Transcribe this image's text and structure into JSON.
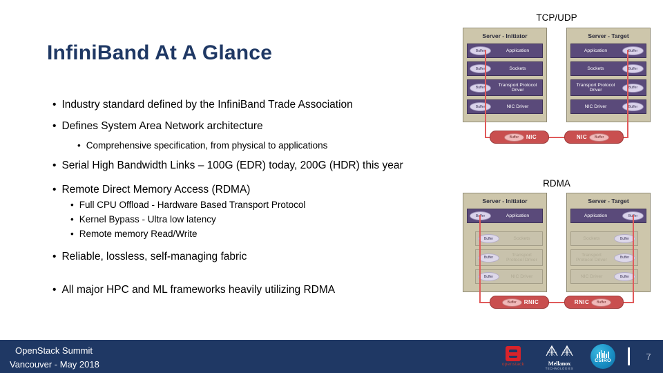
{
  "slide": {
    "title": "InfiniBand At A Glance",
    "number": "7"
  },
  "bullets": [
    {
      "level": 1,
      "text": "Industry standard defined by the InfiniBand Trade Association"
    },
    {
      "level": 1,
      "text": "Defines System Area Network architecture"
    },
    {
      "level": 2,
      "text": "Comprehensive specification, from physical to applications"
    },
    {
      "level": 1,
      "text": "Serial High Bandwidth Links – 100G (EDR) today, 200G (HDR) this year"
    },
    {
      "level": 1,
      "text": "Remote Direct Memory Access (RDMA)"
    },
    {
      "level": 2,
      "text": "Full CPU Offload - Hardware Based Transport Protocol"
    },
    {
      "level": 2,
      "text": "Kernel Bypass - Ultra low latency"
    },
    {
      "level": 2,
      "text": "Remote memory Read/Write"
    },
    {
      "level": 1,
      "text": "Reliable, lossless, self-managing fabric"
    },
    {
      "level": 1,
      "text": "All major HPC and ML frameworks heavily utilizing RDMA"
    }
  ],
  "bullet_glyph": "•",
  "diagrams": {
    "tcp": {
      "label": "TCP/UDP",
      "initiator_title": "Server - Initiator",
      "target_title": "Server - Target",
      "layers": [
        "Application",
        "Sockets",
        "Transport Protocol Driver",
        "NIC Driver"
      ],
      "buffer_label": "Buffer",
      "nic_label": "NIC"
    },
    "rdma": {
      "label": "RDMA",
      "initiator_title": "Server - Initiator",
      "target_title": "Server - Target",
      "layers": [
        "Application",
        "Sockets",
        "Transport Protocol Driver",
        "NIC Driver"
      ],
      "buffer_label": "Buffer",
      "nic_label": "RNIC"
    }
  },
  "footer": {
    "line1": "OpenStack Summit",
    "line2": "Vancouver - May 2018",
    "logos": [
      {
        "name": "openstack",
        "text": "openstack"
      },
      {
        "name": "mellanox",
        "text": "Mellanox",
        "sub": "TECHNOLOGIES"
      },
      {
        "name": "csiro",
        "text": "CSIRO"
      }
    ]
  },
  "colors": {
    "brand_navy": "#1f3864",
    "server_tan": "#cdc6ab",
    "layer_purple": "#5a4a7a",
    "nic_red": "#c94f4f",
    "flow_red": "#e05a5a",
    "openstack_red": "#d8232a",
    "csiro_blue": "#1a8fc4"
  }
}
